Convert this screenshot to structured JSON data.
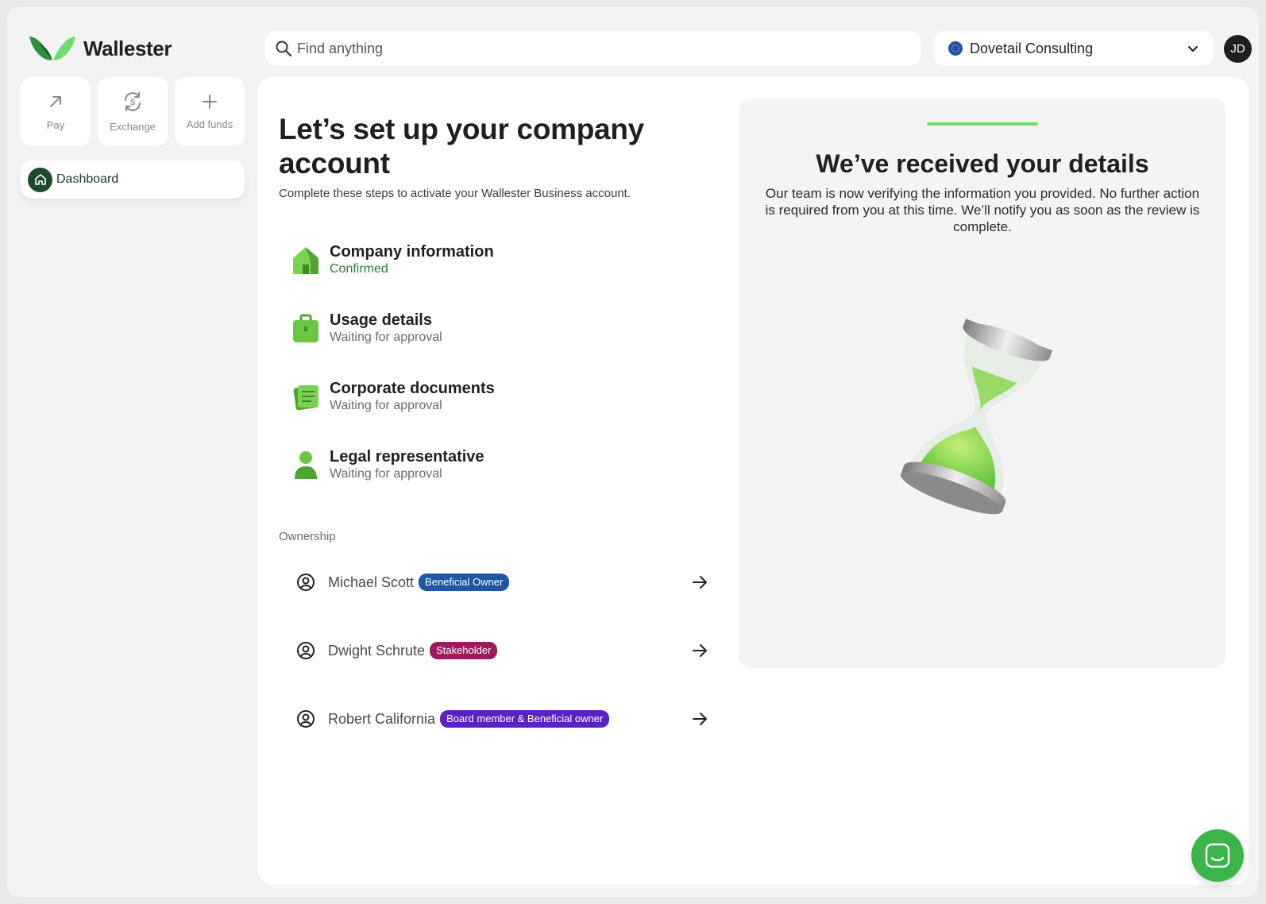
{
  "brand": {
    "name": "Wallester"
  },
  "search": {
    "placeholder": "Find anything"
  },
  "company": {
    "name": "Dovetail Consulting"
  },
  "user": {
    "initials": "JD"
  },
  "quick_actions": [
    {
      "label": "Pay",
      "icon": "arrow-up-right-icon"
    },
    {
      "label": "Exchange",
      "icon": "currency-exchange-icon"
    },
    {
      "label": "Add funds",
      "icon": "plus-icon"
    }
  ],
  "nav": {
    "dashboard": "Dashboard"
  },
  "setup": {
    "title": "Let’s set up your company account",
    "subtitle": "Complete these steps to activate your Wallester Business account.",
    "steps": [
      {
        "name": "Company information",
        "status": "Confirmed",
        "icon": "house-icon"
      },
      {
        "name": "Usage details",
        "status": "Waiting for approval",
        "icon": "briefcase-icon"
      },
      {
        "name": "Corporate documents",
        "status": "Waiting for approval",
        "icon": "documents-icon"
      },
      {
        "name": "Legal representative",
        "status": "Waiting for approval",
        "icon": "person-icon"
      }
    ],
    "ownership_label": "Ownership",
    "owners": [
      {
        "name": "Michael Scott",
        "role": "Beneficial Owner",
        "color": "#1f56a8"
      },
      {
        "name": "Dwight Schrute",
        "role": "Stakeholder",
        "color": "#9c1a5d"
      },
      {
        "name": "Robert California",
        "role": "Board member & Beneficial owner",
        "color": "#5a22c2"
      }
    ]
  },
  "status_card": {
    "title": "We’ve received your details",
    "text": "Our team is now verifying the information you provided. No further action is required from you at this time. We’ll notify you as soon as the review is complete.",
    "progress": 1.0
  },
  "colors": {
    "accent": "#3bb54a",
    "progress": "#6fdc6f"
  }
}
